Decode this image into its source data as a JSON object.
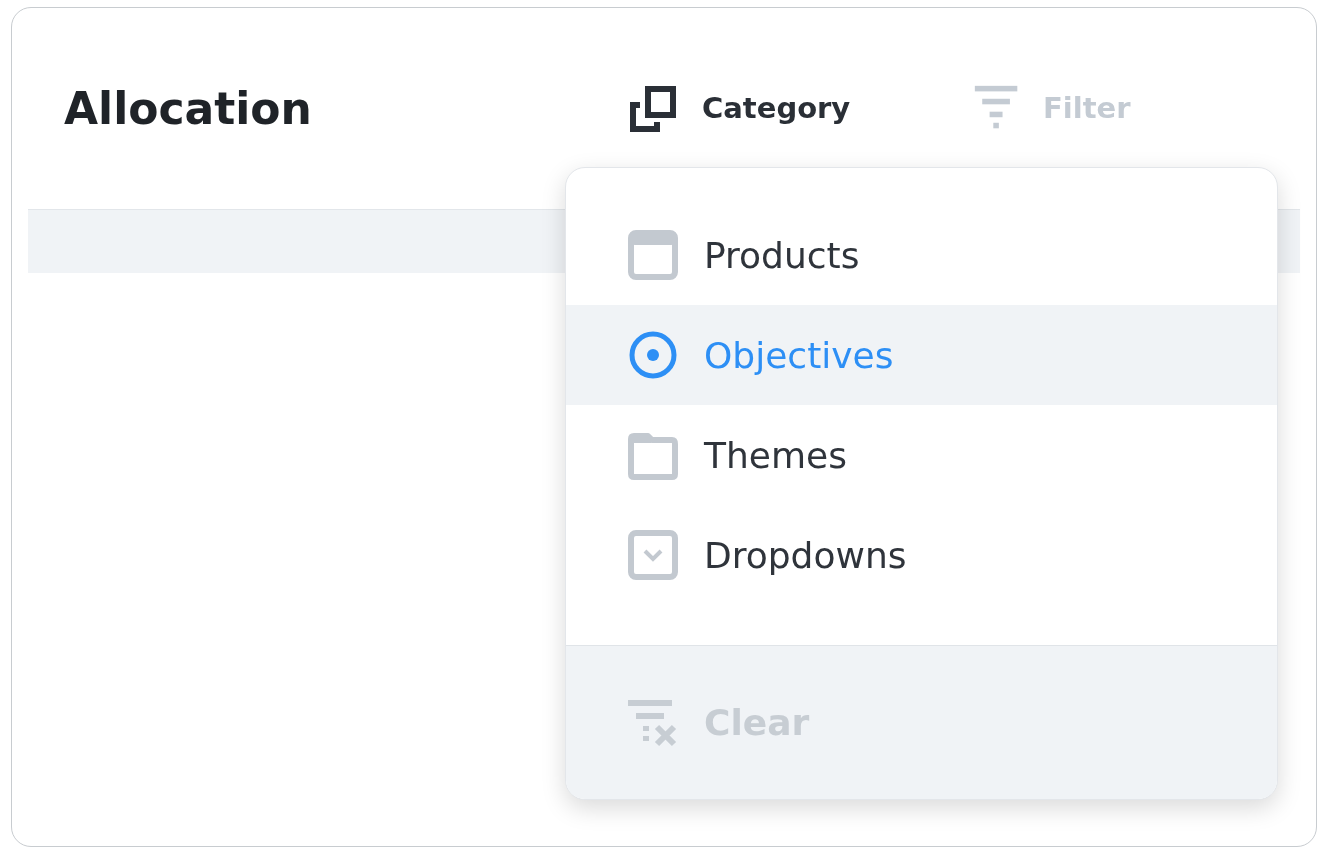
{
  "title": "Allocation",
  "toolbar": [
    {
      "kind": "category",
      "label": "Category",
      "disabled": false
    },
    {
      "kind": "filter",
      "label": "Filter",
      "disabled": true
    }
  ],
  "menu": {
    "items": [
      {
        "kind": "products",
        "label": "Products",
        "selected": false
      },
      {
        "kind": "objectives",
        "label": "Objectives",
        "selected": true
      },
      {
        "kind": "themes",
        "label": "Themes",
        "selected": false
      },
      {
        "kind": "dropdowns",
        "label": "Dropdowns",
        "selected": false
      }
    ],
    "footer": {
      "label": "Clear",
      "disabled": true
    }
  }
}
